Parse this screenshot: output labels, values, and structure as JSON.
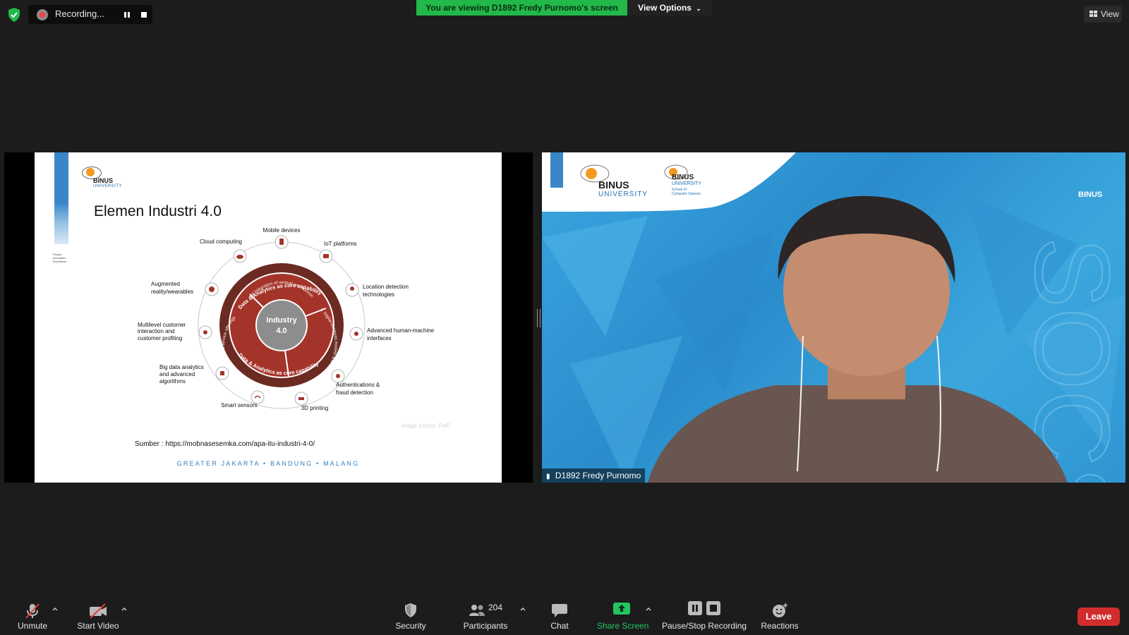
{
  "top_bar": {
    "recording_label": "Recording...",
    "viewing_banner": "You are viewing D1892 Fredy Purnomo's screen",
    "view_options_label": "View Options",
    "view_label": "View"
  },
  "slide": {
    "logo_word": "BINUS",
    "logo_sub": "UNIVERSITY",
    "tagline": "People Innovation Excellence",
    "title": "Elemen Industri 4.0",
    "center_line1": "Industry",
    "center_line2": "4.0",
    "ring_top": "Data & Analytics as core capability",
    "ring_bottom": "Data & Analytics as core capability",
    "segment_1": "1. Digitisation and integration of vertical and horizontal value chains",
    "segment_2": "2. Digitisation of product and service offerings",
    "segment_3": "3. Digital business models and customer access",
    "items": {
      "mobile": "Mobile devices",
      "cloud": "Cloud computing",
      "iot": "IoT platforms",
      "ar": [
        "Augmented",
        "reality/wearables"
      ],
      "location": [
        "Location detection",
        "technologies"
      ],
      "multilevel": [
        "Multilevel customer",
        "interaction and",
        "customer profiling"
      ],
      "hmi": [
        "Advanced human-machine",
        "interfaces"
      ],
      "bigdata": [
        "Big data analytics",
        "and advanced",
        "algorithms"
      ],
      "auth": [
        "Authentications &",
        "fraud detection"
      ],
      "sensors": "Smart sensors",
      "printing": "3D printing"
    },
    "image_credit": "image source: PwC",
    "source": "Sumber : https://mobnasesemka.com/apa-itu-industri-4-0/",
    "footer": "GREATER JAKARTA • BANDUNG • MALANG"
  },
  "video": {
    "participant_name": "D1892 Fredy Purnomo",
    "banner_word": "BINUS",
    "banner_sub": "UNIVERSITY",
    "banner_school": [
      "School of",
      "Computer Science"
    ],
    "corner_logo": "BINUS"
  },
  "toolbar": {
    "unmute": "Unmute",
    "start_video": "Start Video",
    "security": "Security",
    "participants": "Participants",
    "participant_count": "204",
    "chat": "Chat",
    "share_screen": "Share Screen",
    "pause_stop": "Pause/Stop Recording",
    "reactions": "Reactions",
    "leave": "Leave"
  },
  "colors": {
    "banner_green": "#22b84a",
    "share_green": "#22c55e",
    "leave_red": "#d22d2d",
    "diagram_dark": "#6b2a22",
    "diagram_red": "#a4342a"
  }
}
